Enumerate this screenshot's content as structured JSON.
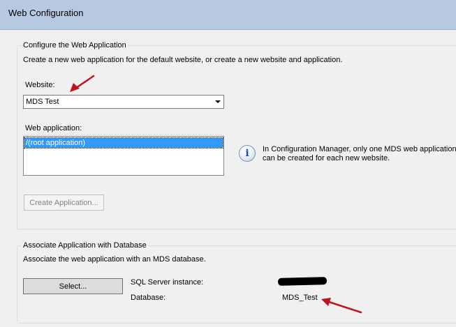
{
  "header": {
    "title": "Web Configuration"
  },
  "web_app_group": {
    "legend": "Configure the Web Application",
    "description": "Create a new web application for the default website, or create a new website and application.",
    "website_label": "Website:",
    "website_value": "MDS Test",
    "web_application_label": "Web application:",
    "web_applications": [
      "/(root application)"
    ],
    "info_lines": [
      "In Configuration Manager, only one MDS web application",
      "can be created for each new website."
    ],
    "create_button": "Create Application..."
  },
  "db_group": {
    "legend": "Associate Application with Database",
    "description": "Associate the web application with an MDS database.",
    "select_button": "Select...",
    "sql_instance_label": "SQL Server instance:",
    "database_label": "Database:",
    "database_value": "MDS_Test"
  },
  "colors": {
    "header_bg": "#b7c8e2",
    "annotation_arrow": "#c0141b",
    "selection": "#3399ff"
  },
  "icons": [
    "info-icon",
    "chevron-down-icon",
    "annotation-arrow-icon"
  ]
}
